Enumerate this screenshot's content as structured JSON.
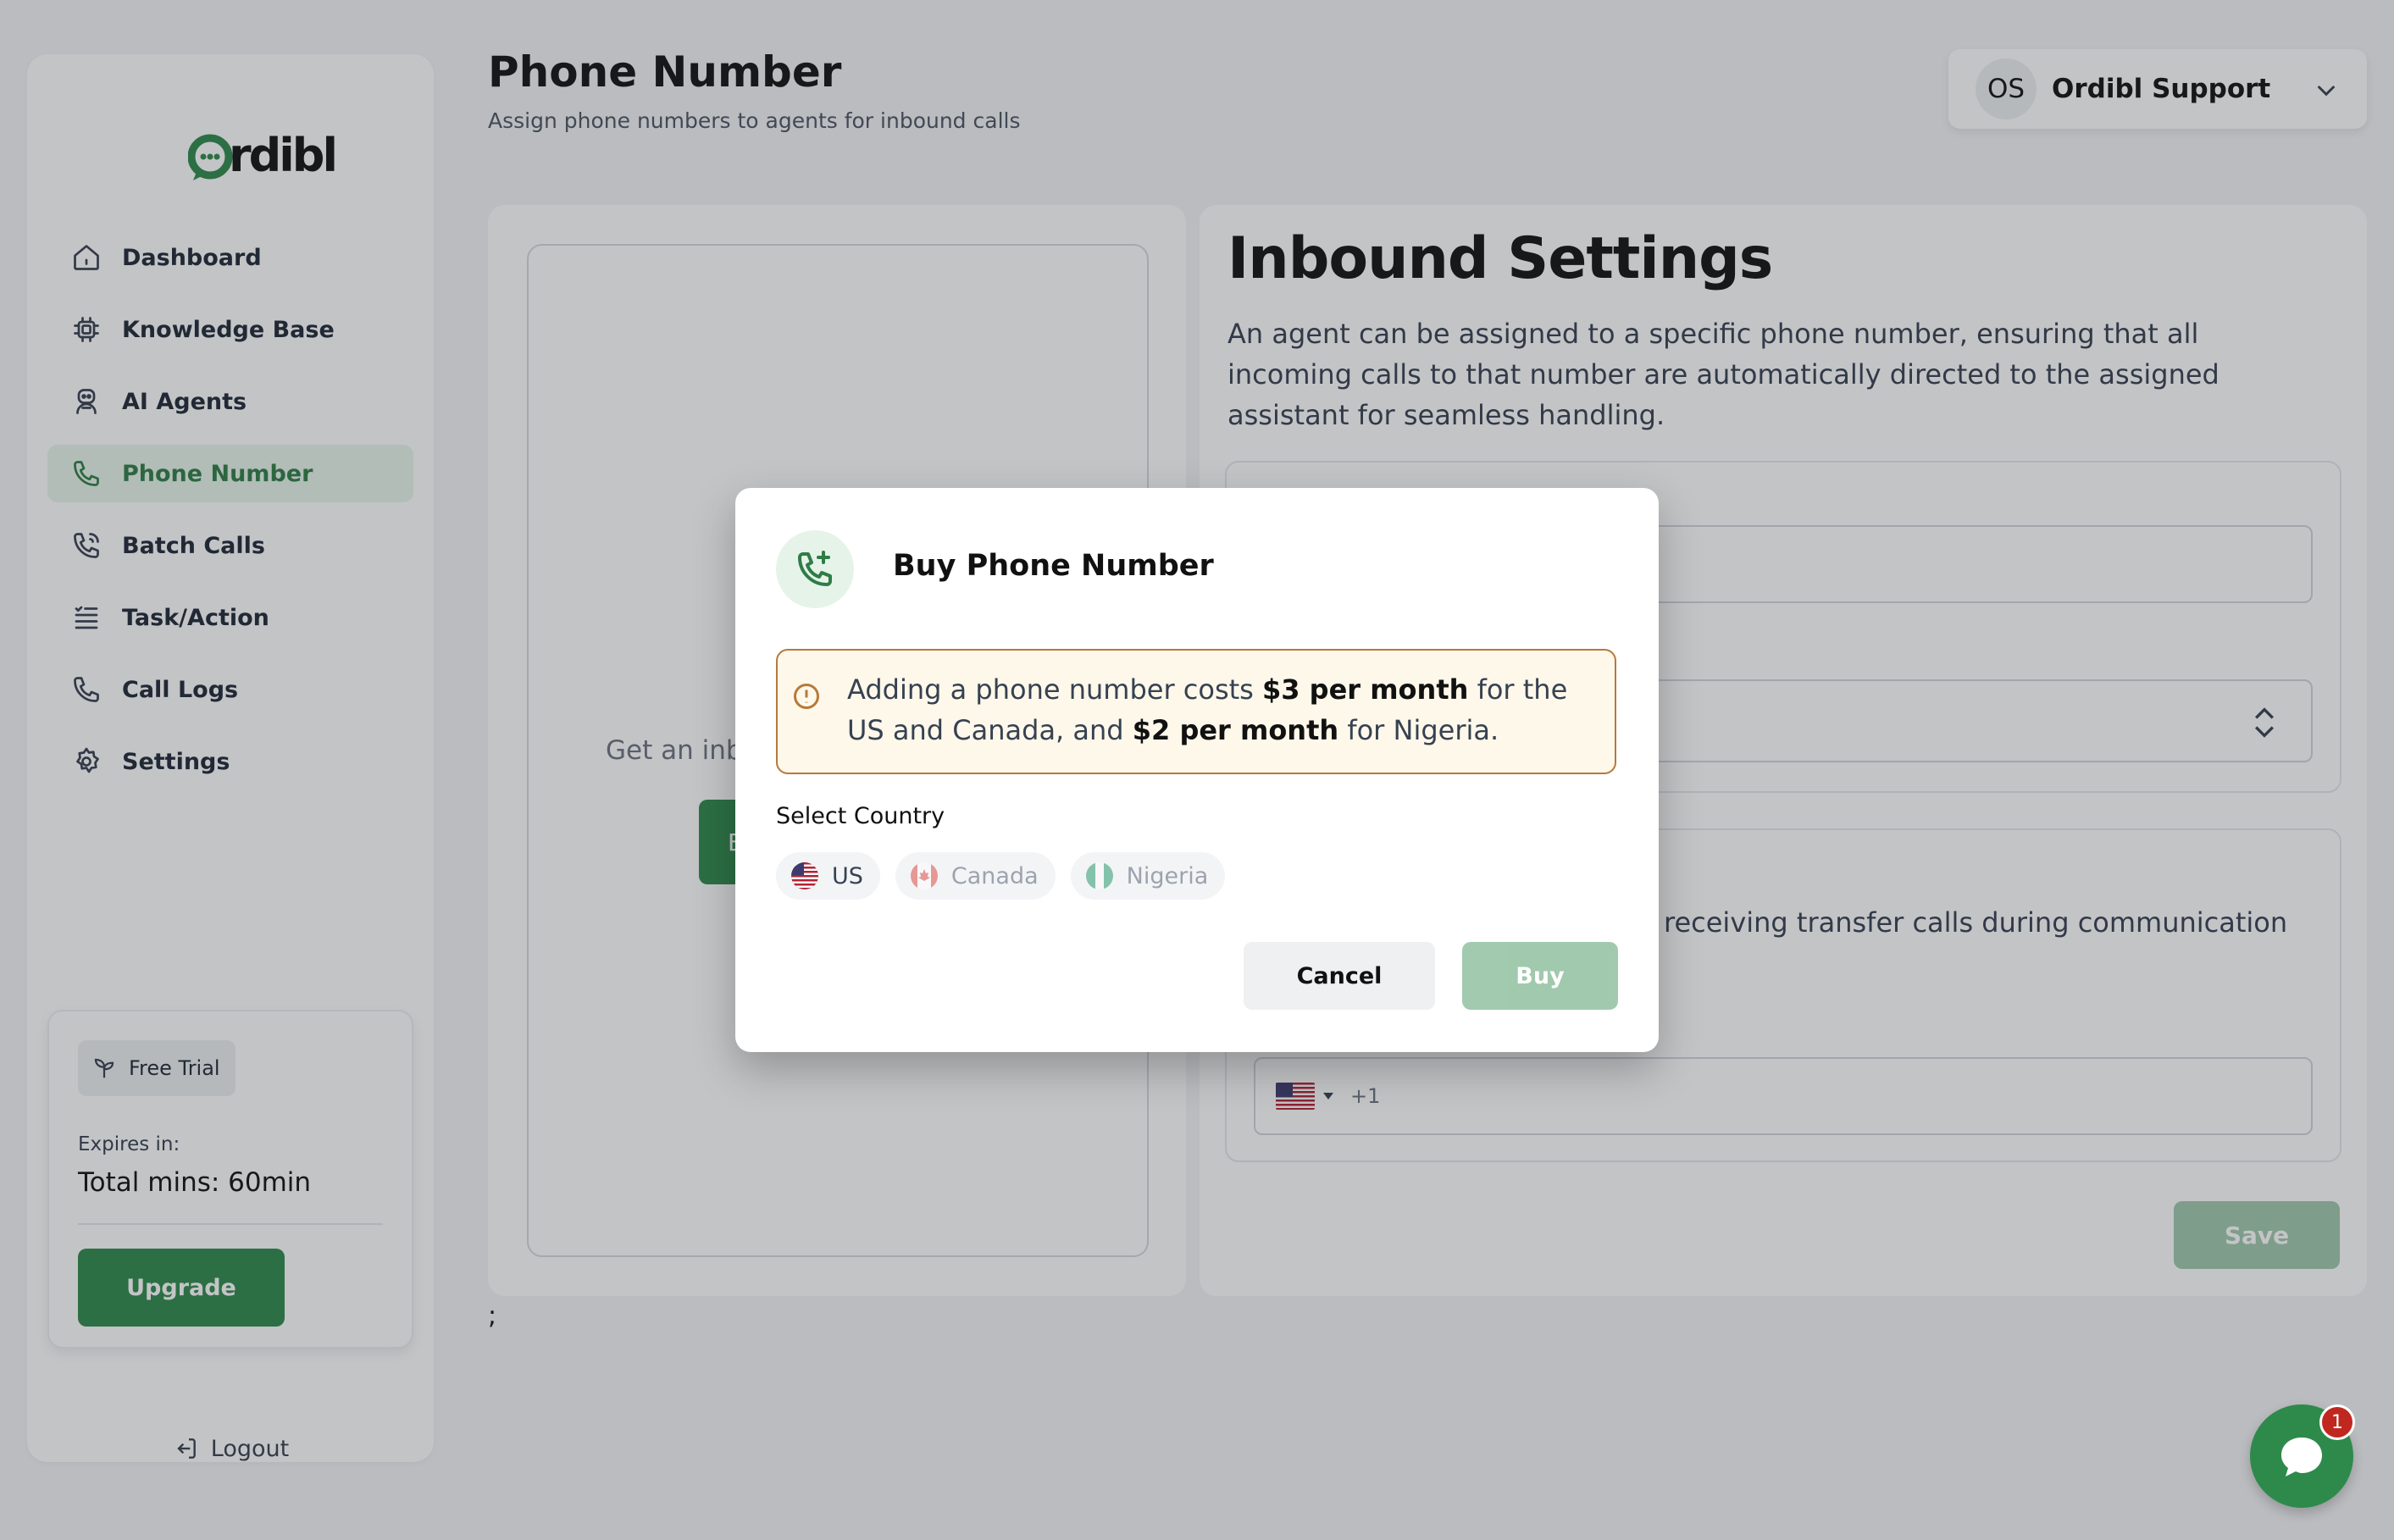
{
  "brand": {
    "logo_text": "rdibl",
    "accent": "#2e8a4b"
  },
  "header": {
    "title": "Phone Number",
    "subtitle": "Assign phone numbers to agents for inbound calls",
    "account_initials": "OS",
    "account_name": "Ordibl Support"
  },
  "sidebar": {
    "items": [
      {
        "label": "Dashboard",
        "icon": "home-icon"
      },
      {
        "label": "Knowledge Base",
        "icon": "chip-icon"
      },
      {
        "label": "AI Agents",
        "icon": "robot-icon"
      },
      {
        "label": "Phone Number",
        "icon": "phone-icon",
        "active": true
      },
      {
        "label": "Batch Calls",
        "icon": "phone-waves-icon"
      },
      {
        "label": "Task/Action",
        "icon": "list-icon"
      },
      {
        "label": "Call Logs",
        "icon": "phone-icon"
      },
      {
        "label": "Settings",
        "icon": "gear-icon"
      }
    ],
    "trial": {
      "badge": "Free Trial",
      "expires_label": "Expires in:",
      "total_mins": "Total mins: 60min",
      "upgrade_label": "Upgrade"
    },
    "logout_label": "Logout"
  },
  "left_panel": {
    "get_inbound_text": "Get an inb",
    "button_fragment": "E",
    "trailing_text": ";"
  },
  "inbound": {
    "title": "Inbound Settings",
    "description": "An agent can be assigned to a specific phone number, ensuring that all incoming calls to that number are automatically directed to the assigned assistant for seamless handling.",
    "transfer_text": "receiving transfer calls during communication",
    "dial_code": "+1",
    "save_label": "Save"
  },
  "modal": {
    "title": "Buy Phone Number",
    "notice": {
      "part1": "Adding a phone number costs ",
      "bold1": "$3 per month",
      "part2": " for the US and Canada, and ",
      "bold2": "$2 per month",
      "part3": " for Nigeria."
    },
    "select_label": "Select Country",
    "countries": [
      {
        "label": "US",
        "selected": true
      },
      {
        "label": "Canada",
        "selected": false
      },
      {
        "label": "Nigeria",
        "selected": false
      }
    ],
    "cancel_label": "Cancel",
    "buy_label": "Buy"
  },
  "chat": {
    "badge_count": "1"
  }
}
